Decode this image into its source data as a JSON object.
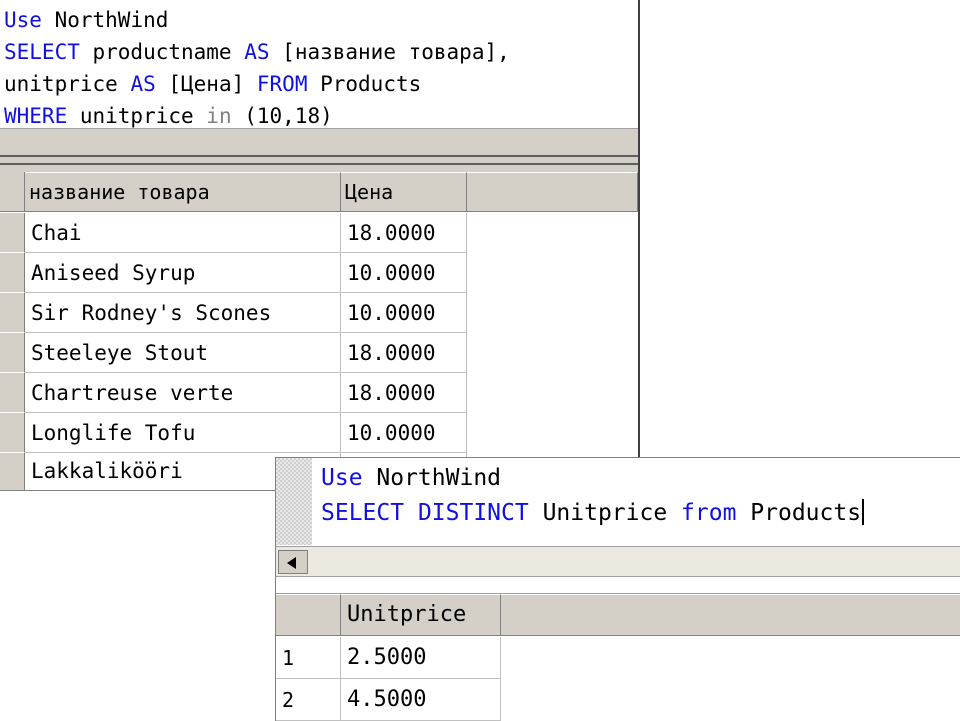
{
  "query1": {
    "line1": {
      "kw": "Use",
      "rest": " NorthWind"
    },
    "line2": {
      "kw1": "SELECT",
      "mid": " productname ",
      "kw2": "AS",
      "rest": " [название товара],"
    },
    "line3": {
      "pre": "unitprice ",
      "kw1": "AS",
      "mid": " [Цена] ",
      "kw2": "FROM",
      "rest": " Products"
    },
    "line4": {
      "kw": "WHERE",
      "mid": " unitprice ",
      "op": "in",
      "rest": " (10,18)"
    }
  },
  "grid1": {
    "columns": [
      "название товара",
      "Цена"
    ],
    "rows": [
      [
        "Chai",
        "18.0000"
      ],
      [
        "Aniseed Syrup",
        "10.0000"
      ],
      [
        "Sir Rodney's Scones",
        "10.0000"
      ],
      [
        "Steeleye Stout",
        "18.0000"
      ],
      [
        "Chartreuse verte",
        "18.0000"
      ],
      [
        "Longlife Tofu",
        "10.0000"
      ],
      [
        "Lakkalikööri",
        ""
      ]
    ]
  },
  "query2": {
    "line1": {
      "kw": "Use",
      "rest": " NorthWind"
    },
    "line2": {
      "kw1": "SELECT",
      "kw2": " DISTINCT",
      "mid": " Unitprice ",
      "kw3": "from",
      "rest": " Products"
    }
  },
  "grid2": {
    "columns": [
      "Unitprice"
    ],
    "rows": [
      {
        "num": "1",
        "value": "2.5000"
      },
      {
        "num": "2",
        "value": "4.5000"
      }
    ]
  },
  "colors": {
    "keyword": "#1010e0",
    "operator": "#808080",
    "grid_header": "#d4d0c8"
  }
}
